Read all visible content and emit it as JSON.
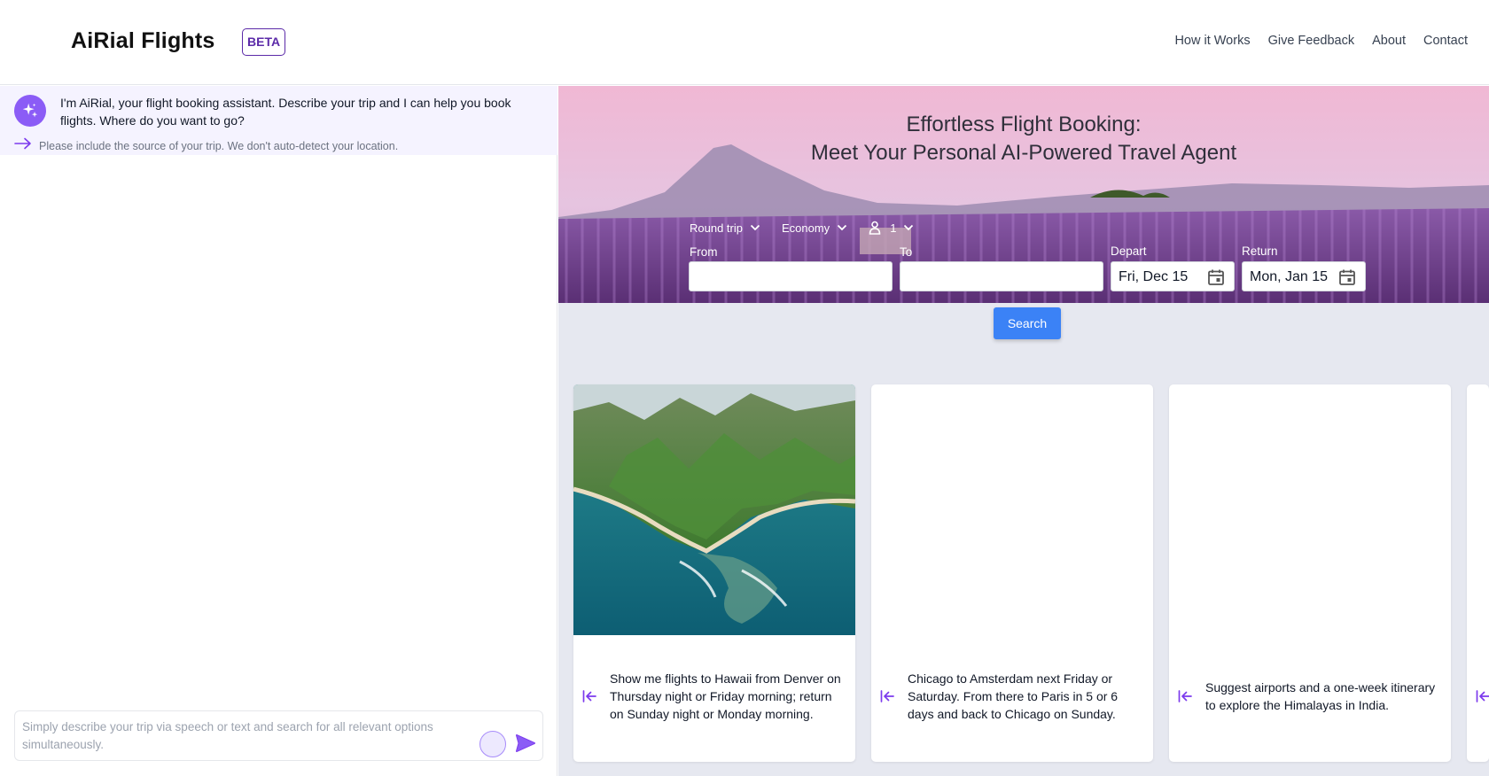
{
  "header": {
    "brand": "AiRial Flights",
    "badge": "BETA",
    "nav": [
      "How it Works",
      "Give Feedback",
      "About",
      "Contact"
    ]
  },
  "chat": {
    "assistant_message": "I'm AiRial, your flight booking assistant. Describe your trip and I can help you book flights. Where do you want to go?",
    "hint": "Please include the source of your trip. We don't auto-detect your location.",
    "composer_placeholder": "Simply describe your trip via speech or text and search for all relevant options simultaneously."
  },
  "hero": {
    "title_line1": "Effortless Flight Booking:",
    "title_line2": "Meet Your Personal AI-Powered Travel Agent"
  },
  "search_form": {
    "trip_type": "Round trip",
    "cabin_class": "Economy",
    "passengers": "1",
    "from_label": "From",
    "from_value": "",
    "to_label": "To",
    "to_value": "",
    "depart_label": "Depart",
    "depart_value": "Fri, Dec 15",
    "return_label": "Return",
    "return_value": "Mon, Jan 15",
    "search_label": "Search"
  },
  "suggestion_cards": [
    {
      "text": "Show me flights to Hawaii from Denver on Thursday night or Friday morning; return on Sunday night or Monday morning.",
      "has_image": true
    },
    {
      "text": "Chicago to Amsterdam next Friday or Saturday. From there to Paris in 5 or 6 days and back to Chicago on Sunday.",
      "has_image": false
    },
    {
      "text": "Suggest airports and a one-week itinerary to explore the Himalayas in India.",
      "has_image": false
    }
  ],
  "colors": {
    "accent_purple": "#8b5cf6",
    "badge_purple": "#5b2aa8",
    "search_blue": "#3b82f6",
    "panel_tint": "#f5f3ff",
    "main_bg": "#e6e8f0"
  }
}
